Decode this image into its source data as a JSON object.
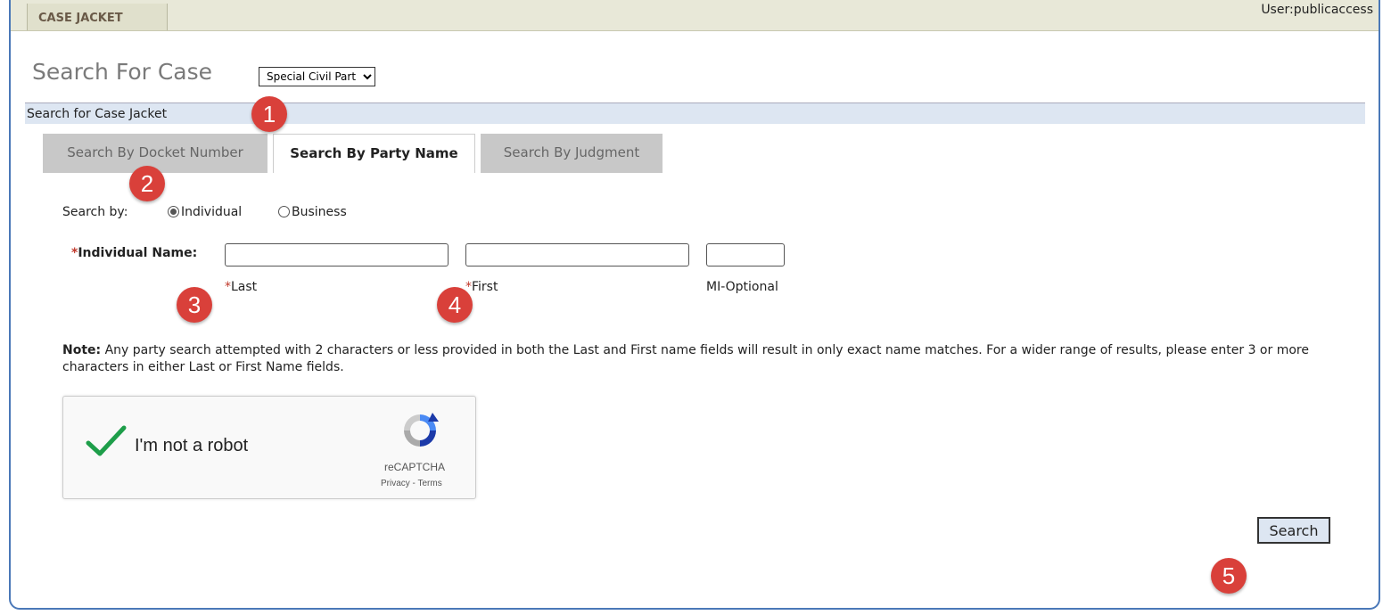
{
  "header": {
    "tab_label": "CASE JACKET",
    "user": "User:publicaccess"
  },
  "page": {
    "title": "Search For Case",
    "court_select": {
      "value": "Special Civil Part",
      "options": [
        "Special Civil Part"
      ]
    },
    "section_title": "Search for Case Jacket"
  },
  "tabs": [
    {
      "label": "Search By Docket Number",
      "active": false
    },
    {
      "label": "Search By Party Name",
      "active": true
    },
    {
      "label": "Search By Judgment",
      "active": false
    }
  ],
  "form": {
    "search_by_label": "Search by:",
    "radio_individual": "Individual",
    "radio_business": "Business",
    "selected": "Individual",
    "name_label": "Individual Name:",
    "required_marker": "*",
    "last_label": "Last",
    "first_label": "First",
    "mi_label": "MI-Optional",
    "last_value": "",
    "first_value": "",
    "mi_value": ""
  },
  "note": {
    "bold": "Note:",
    "text": " Any party search attempted with 2 characters or less provided in both the Last and First name fields will result in only exact name matches. For a wider range of results, please enter 3 or more characters in either Last or First Name fields."
  },
  "captcha": {
    "label": "I'm not a robot",
    "brand": "reCAPTCHA",
    "links": "Privacy - Terms"
  },
  "search_button": "Search",
  "markers": [
    "1",
    "2",
    "3",
    "4",
    "5"
  ],
  "colors": {
    "marker": "#d9403a",
    "accent_bar": "#dde6f2",
    "required": "#c0392b",
    "check_green": "#1e9e4a"
  }
}
